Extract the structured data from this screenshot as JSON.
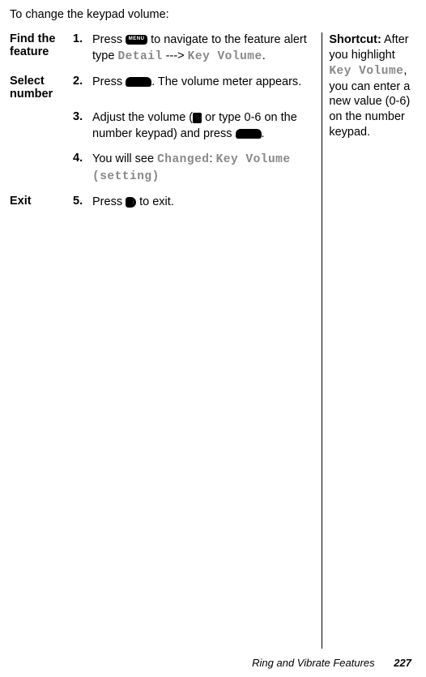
{
  "intro": "To change the keypad volume:",
  "steps": [
    {
      "label": "Find the feature",
      "num": "1.",
      "pre": "Press ",
      "mid1": " to navigate to the feature alert type ",
      "mono1": "Detail",
      "mid2": " ---> ",
      "mono2": "Key Volume",
      "post": "."
    },
    {
      "label": "Select number",
      "num": "2.",
      "pre": "Press ",
      "post": ". The volume meter appears."
    },
    {
      "label": "",
      "num": "3.",
      "pre": "Adjust the volume (",
      "mid1": " or type 0-6 on the number keypad) and press ",
      "post": "."
    },
    {
      "label": "",
      "num": "4.",
      "pre": "You will see ",
      "mono1": "Changed",
      "mid1": ": ",
      "mono2": "Key Volume (setting)"
    },
    {
      "label": "Exit",
      "num": "5.",
      "pre": "Press ",
      "post": " to exit."
    }
  ],
  "sidebar": {
    "heading": "Shortcut:",
    "text1": "After you highlight ",
    "mono1": "Key Volume",
    "text2": ", you can enter a new value (0-6) on the number keypad."
  },
  "footer": {
    "title": "Ring and Vibrate Features",
    "page": "227"
  },
  "icons": {
    "menu_label": "MENU"
  }
}
